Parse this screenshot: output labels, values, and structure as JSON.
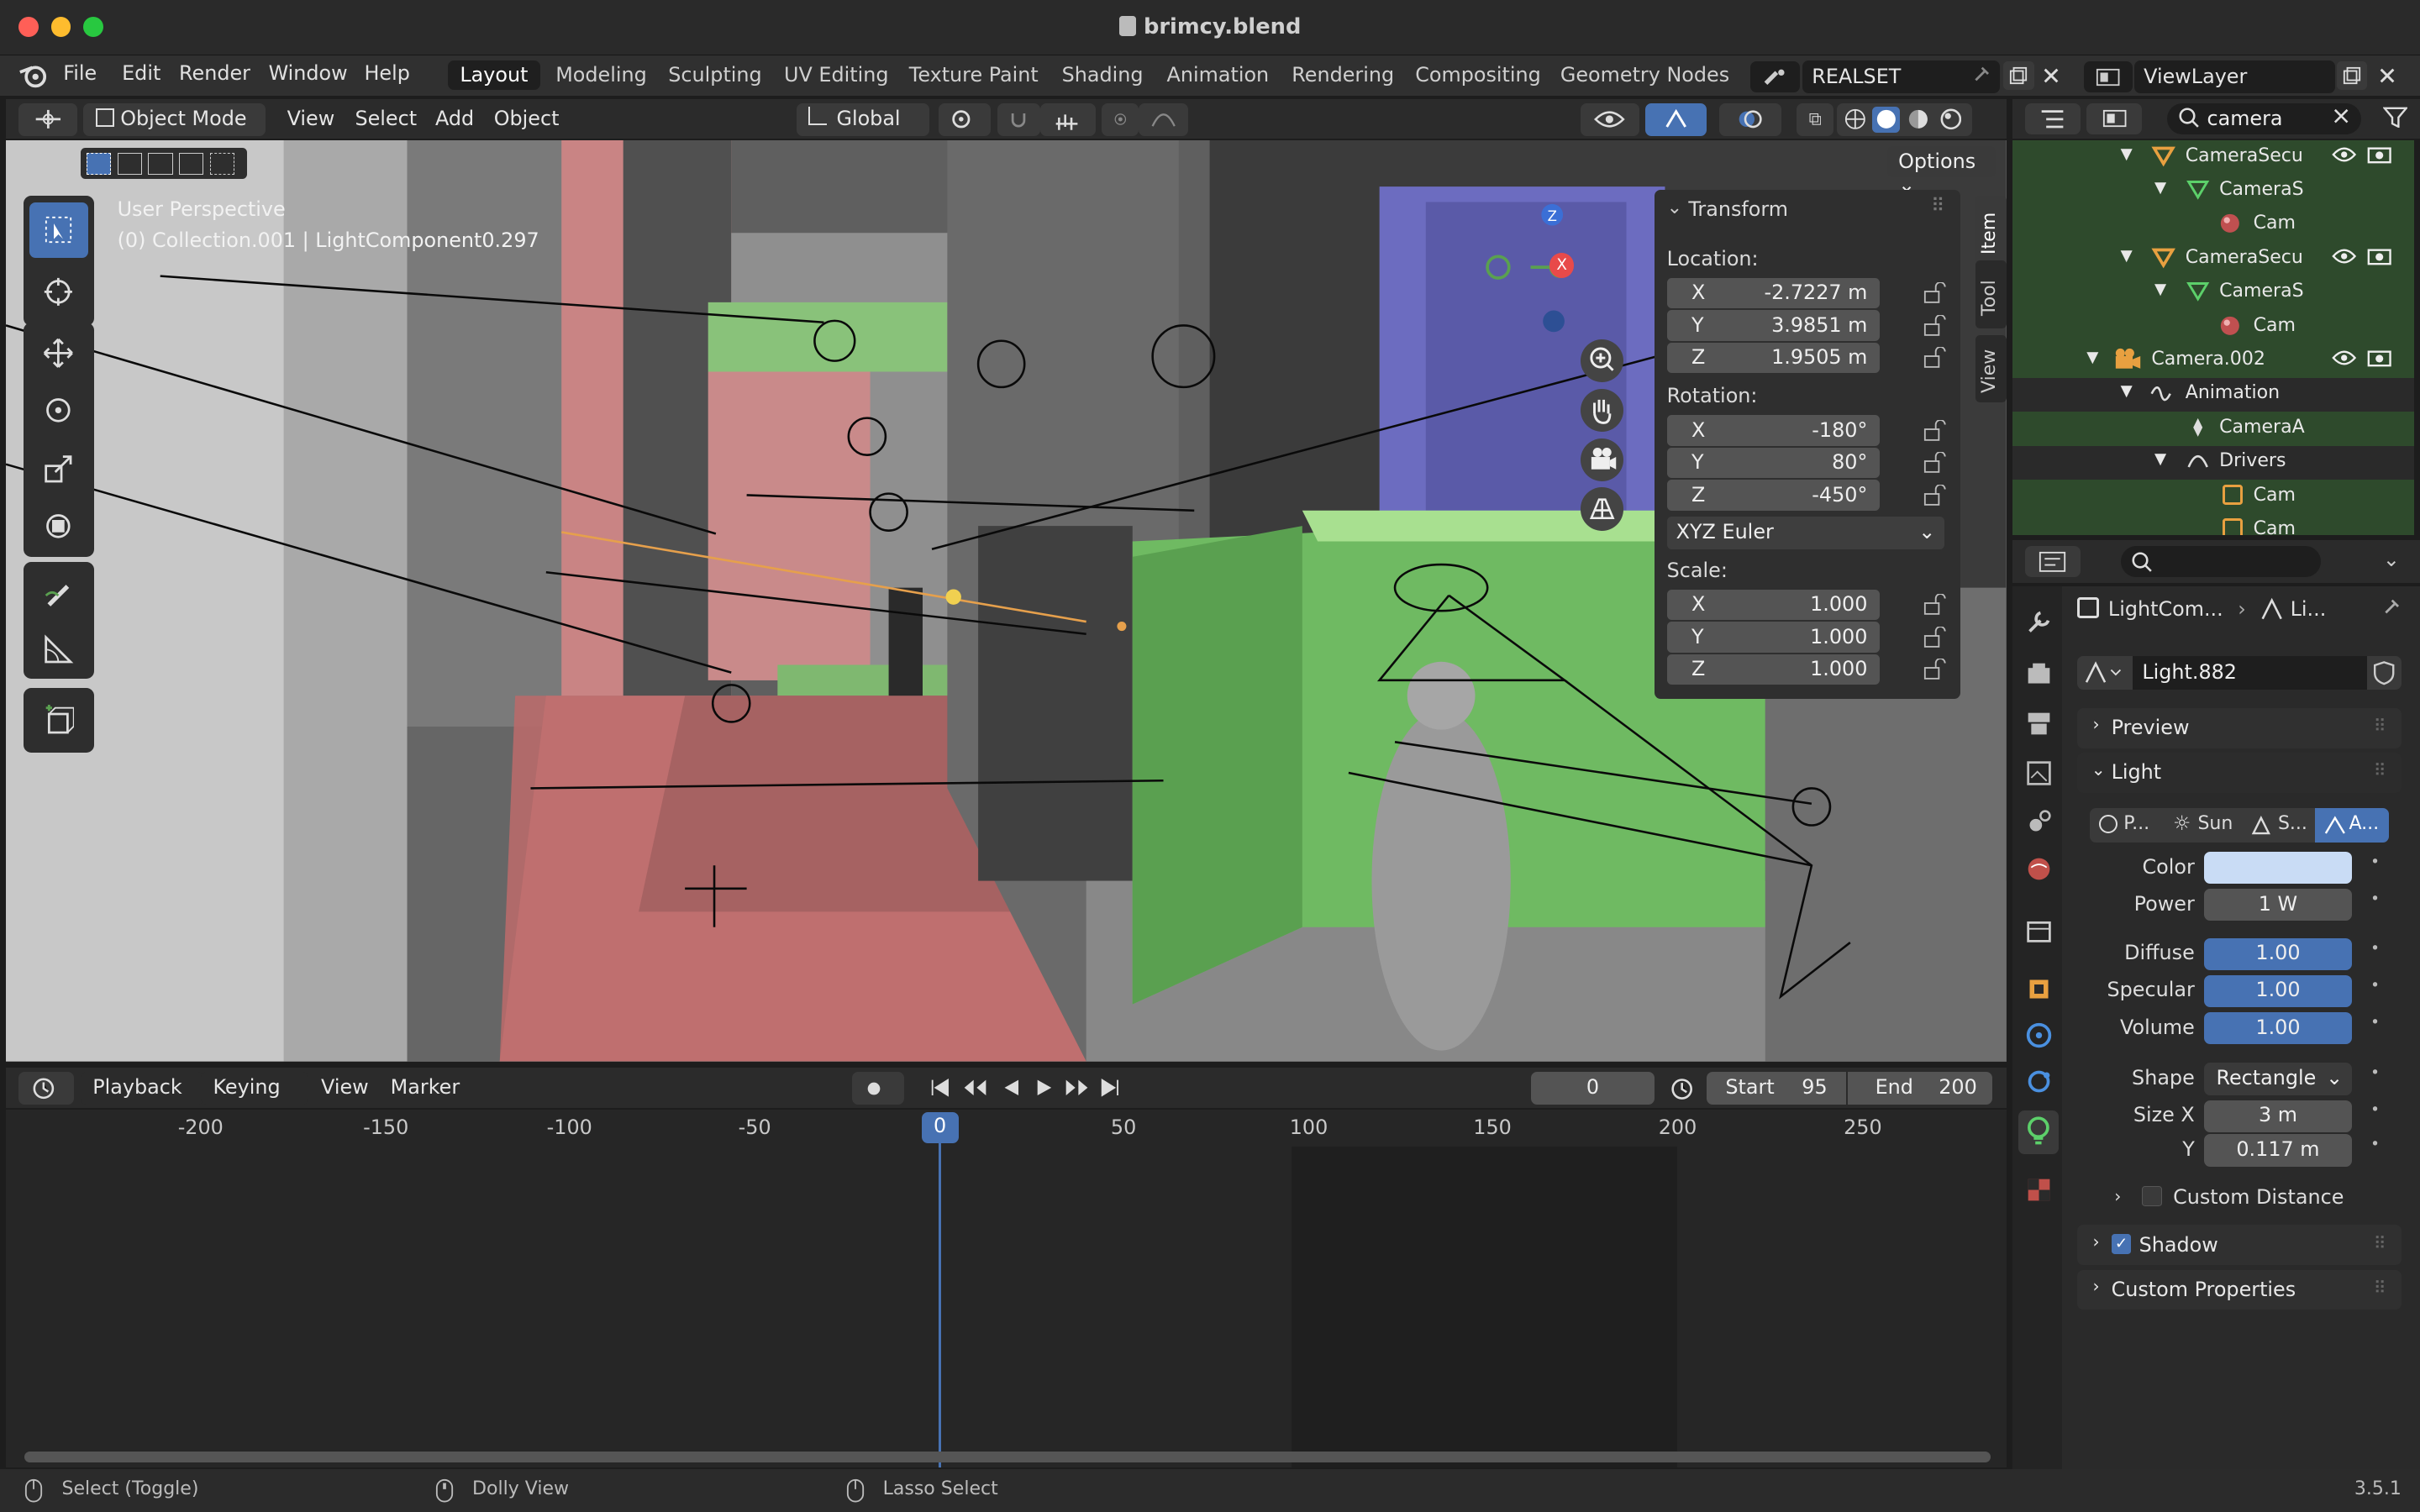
{
  "window": {
    "title": "brimcy.blend"
  },
  "menus": [
    "File",
    "Edit",
    "Render",
    "Window",
    "Help"
  ],
  "workspaces": [
    "Layout",
    "Modeling",
    "Sculpting",
    "UV Editing",
    "Texture Paint",
    "Shading",
    "Animation",
    "Rendering",
    "Compositing",
    "Geometry Nodes"
  ],
  "scene": {
    "name": "REALSET"
  },
  "view_layer": {
    "name": "ViewLayer"
  },
  "viewport_header": {
    "mode": "Object Mode",
    "menus": [
      "View",
      "Select",
      "Add",
      "Object"
    ],
    "orientation": "Global",
    "options": "Options"
  },
  "viewport": {
    "perspective": "User Perspective",
    "collection": "(0) Collection.001 | LightComponent0.297"
  },
  "sidebar_tabs": [
    "Item",
    "Tool",
    "View"
  ],
  "transform": {
    "title": "Transform",
    "location_label": "Location:",
    "location": [
      {
        "axis": "X",
        "value": "-2.7227 m"
      },
      {
        "axis": "Y",
        "value": "3.9851 m"
      },
      {
        "axis": "Z",
        "value": "1.9505 m"
      }
    ],
    "rotation_label": "Rotation:",
    "rotation": [
      {
        "axis": "X",
        "value": "-180°"
      },
      {
        "axis": "Y",
        "value": "80°"
      },
      {
        "axis": "Z",
        "value": "-450°"
      }
    ],
    "rotation_mode": "XYZ Euler",
    "scale_label": "Scale:",
    "scale": [
      {
        "axis": "X",
        "value": "1.000"
      },
      {
        "axis": "Y",
        "value": "1.000"
      },
      {
        "axis": "Z",
        "value": "1.000"
      }
    ]
  },
  "outliner": {
    "search": "camera",
    "rows": [
      {
        "label": "CameraSecu"
      },
      {
        "label": "CameraS"
      },
      {
        "label": "Cam"
      },
      {
        "label": "CameraSecu"
      },
      {
        "label": "CameraS"
      },
      {
        "label": "Cam"
      },
      {
        "label": "Camera.002"
      },
      {
        "label": "Animation"
      },
      {
        "label": "CameraA"
      },
      {
        "label": "Drivers"
      },
      {
        "label": "Cam"
      },
      {
        "label": "Cam"
      }
    ]
  },
  "properties": {
    "breadcrumb": [
      "LightCom...",
      "Li..."
    ],
    "datablock": "Light.882",
    "panels": {
      "preview": "Preview",
      "light": "Light",
      "shadow": "Shadow",
      "custom": "Custom Properties"
    },
    "light_types": [
      "P...",
      "Sun",
      "S...",
      "A..."
    ],
    "color_label": "Color",
    "color": "#c9dcf5",
    "power": {
      "label": "Power",
      "value": "1 W"
    },
    "diffuse": {
      "label": "Diffuse",
      "value": "1.00"
    },
    "specular": {
      "label": "Specular",
      "value": "1.00"
    },
    "volume": {
      "label": "Volume",
      "value": "1.00"
    },
    "shape": {
      "label": "Shape",
      "value": "Rectangle"
    },
    "size_x": {
      "label": "Size X",
      "value": "3 m"
    },
    "size_y": {
      "label": "Y",
      "value": "0.117 m"
    },
    "custom_distance": "Custom Distance"
  },
  "timeline": {
    "menus": [
      "Playback",
      "Keying",
      "View",
      "Marker"
    ],
    "current_frame": "0",
    "start_label": "Start",
    "start": "95",
    "end_label": "End",
    "end": "200",
    "ticks": [
      "-200",
      "-150",
      "-100",
      "-50",
      "0",
      "50",
      "100",
      "150",
      "200",
      "250"
    ]
  },
  "status": {
    "select": "Select (Toggle)",
    "dolly": "Dolly View",
    "lasso": "Lasso Select",
    "version": "3.5.1"
  },
  "colors": {
    "accent": "#4772b3",
    "outliner_bg": "#2e4a2c",
    "active_frame": "#4772b3"
  }
}
